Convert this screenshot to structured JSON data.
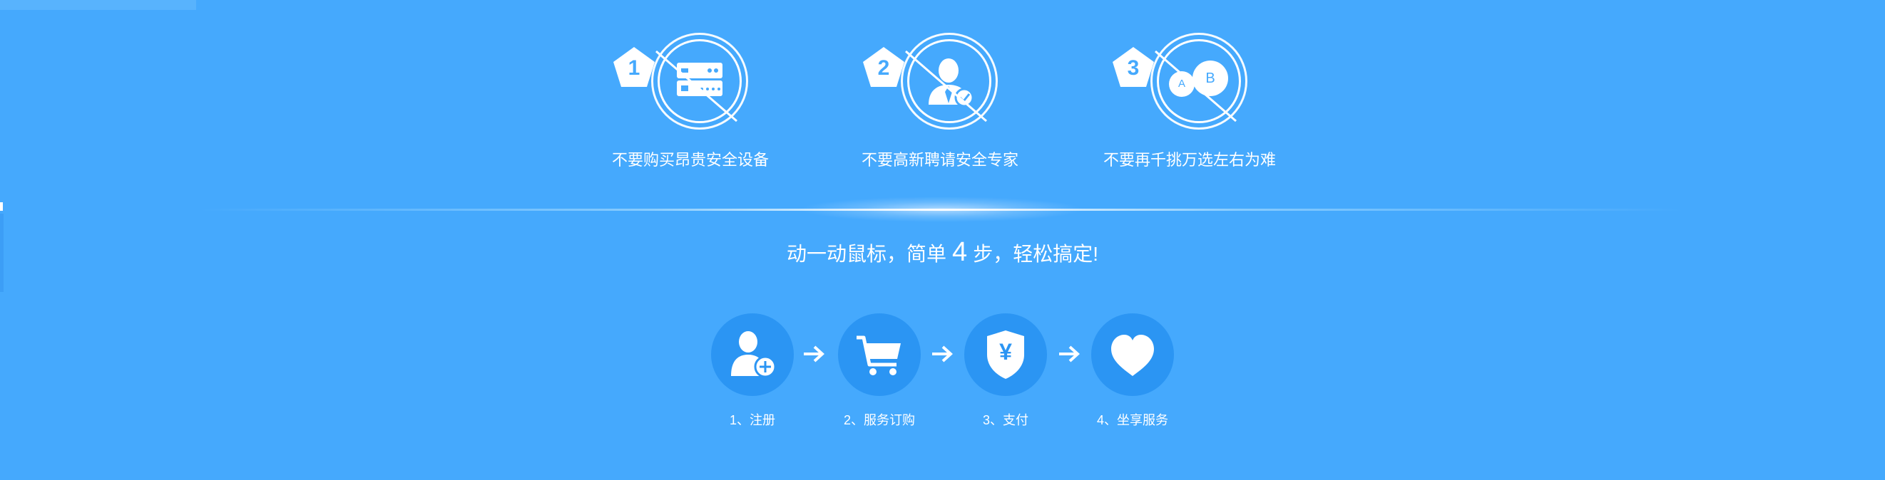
{
  "features": [
    {
      "number": "1",
      "caption": "不要购买昂贵安全设备",
      "icon": "server-icon"
    },
    {
      "number": "2",
      "caption": "不要高新聘请安全专家",
      "icon": "expert-icon"
    },
    {
      "number": "3",
      "caption": "不要再千挑万选左右为难",
      "icon": "choice-icon",
      "choice_a": "A",
      "choice_b": "B"
    }
  ],
  "tagline": {
    "before": "动一动鼠标，简单",
    "count": "4",
    "after": "步，轻松搞定!"
  },
  "steps": [
    {
      "label": "1、注册",
      "icon": "user-add-icon"
    },
    {
      "label": "2、服务订购",
      "icon": "cart-icon"
    },
    {
      "label": "3、支付",
      "icon": "shield-yen-icon",
      "symbol": "¥"
    },
    {
      "label": "4、坐享服务",
      "icon": "heart-icon"
    }
  ],
  "colors": {
    "background": "#45a9fd",
    "step_circle": "#2b95f3",
    "text": "#ffffff"
  }
}
